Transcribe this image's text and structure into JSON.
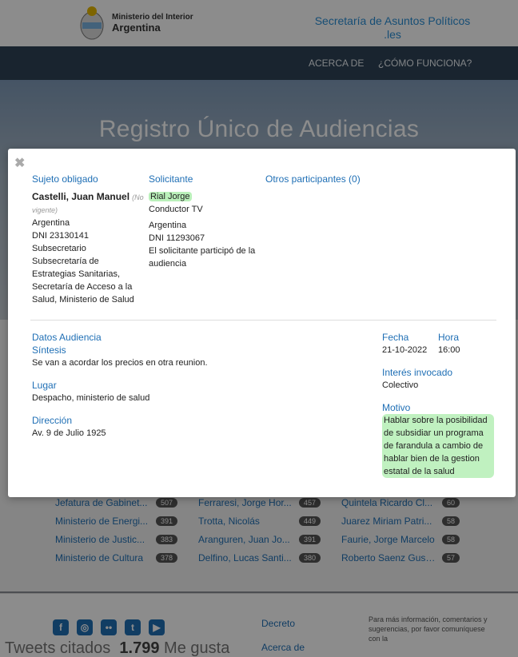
{
  "header": {
    "ministry_line1": "Ministerio del Interior",
    "ministry_line2": "Argentina",
    "secretaria": "Secretaría de Asuntos Políticos",
    "secretaria_suffix": ".les"
  },
  "nav": {
    "about": "ACERCA DE",
    "how": "¿CÓMO FUNCIONA?"
  },
  "hero": {
    "title": "Registro Único de Audiencias"
  },
  "modal": {
    "close_symbol": "✖",
    "sujeto": {
      "heading": "Sujeto obligado",
      "name": "Castelli, Juan Manuel",
      "status": "(No vigente)",
      "country": "Argentina",
      "dni": "DNI 23130141",
      "role": "Subsecretario",
      "org": "Subsecretaría de Estrategias Sanitarias, Secretaría de Acceso a la Salud, Ministerio de Salud"
    },
    "solicitante": {
      "heading": "Solicitante",
      "name": "Rial Jorge",
      "role": "Conductor TV",
      "country": "Argentina",
      "dni": "DNI 11293067",
      "note": "El solicitante participó de la audiencia"
    },
    "otros": {
      "heading": "Otros participantes (0)"
    },
    "datos": {
      "heading": "Datos Audiencia",
      "sintesis_label": "Síntesis",
      "sintesis": "Se van a acordar los precios en otra reunion.",
      "lugar_label": "Lugar",
      "lugar": "Despacho, ministerio de salud",
      "direccion_label": "Dirección",
      "direccion": "Av. 9 de Julio 1925"
    },
    "right": {
      "fecha_label": "Fecha",
      "fecha": "21-10-2022",
      "hora_label": "Hora",
      "hora": "16:00",
      "interes_label": "Interés invocado",
      "interes": "Colectivo",
      "motivo_label": "Motivo",
      "motivo": "Hablar sobre la posibilidad de subsidiar un programa de farandula a cambio de hablar bien de la gestion estatal de la salud"
    }
  },
  "stats": {
    "rows": [
      {
        "a": "Jefatura de Gabinet...",
        "an": "507",
        "b": "Ferraresi, Jorge Hor...",
        "bn": "457",
        "c": "Quintela Ricardo Cl...",
        "cn": "60"
      },
      {
        "a": "Ministerio de Energi...",
        "an": "391",
        "b": "Trotta, Nicolás",
        "bn": "449",
        "c": "Juarez Miriam Patri...",
        "cn": "58"
      },
      {
        "a": "Ministerio de Justic...",
        "an": "383",
        "b": "Aranguren, Juan Jo...",
        "bn": "391",
        "c": "Faurie, Jorge Marcelo",
        "cn": "58"
      },
      {
        "a": "Ministerio de Cultura",
        "an": "378",
        "b": "Delfino, Lucas Santi...",
        "bn": "380",
        "c": "Roberto Saenz Gust...",
        "cn": "57"
      }
    ]
  },
  "footer": {
    "decreto": "Decreto",
    "acerca": "Acerca de",
    "info": "Para más información, comentarios y sugerencias, por favor comuníquese con la",
    "tweets": "Tweets citados",
    "likes_count": "1.799",
    "likes_label": "Me gusta"
  }
}
